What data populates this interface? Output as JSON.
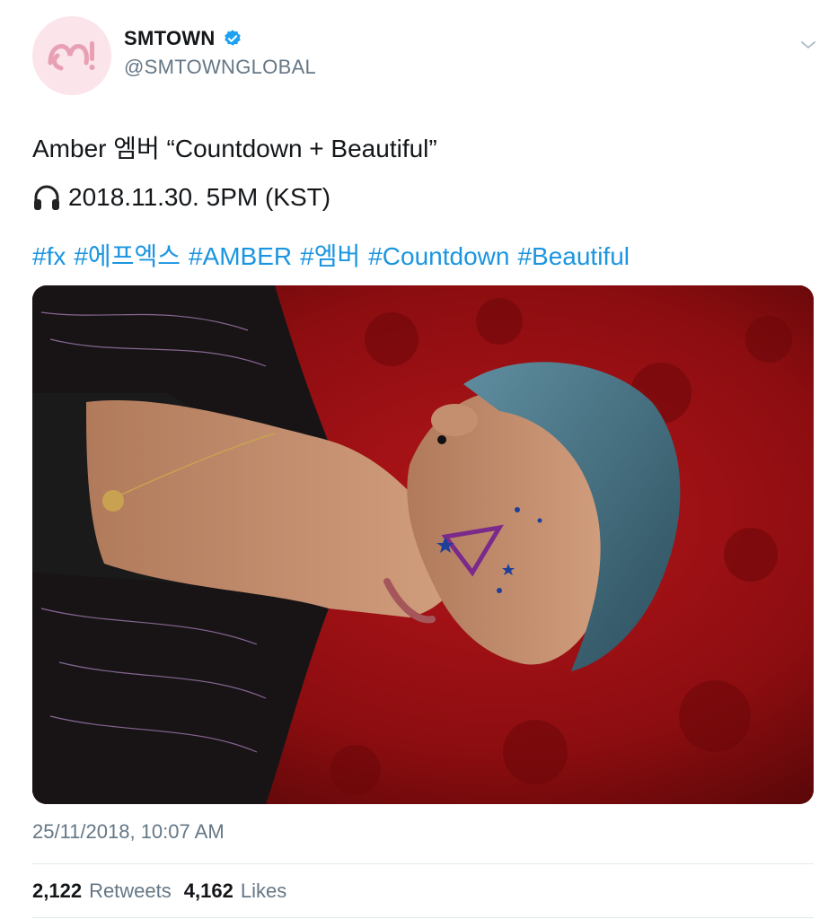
{
  "header": {
    "display_name": "SMTOWN",
    "handle": "@SMTOWNGLOBAL",
    "avatar_icon": "smtown-logo-icon",
    "verified_icon": "verified-badge-icon",
    "menu_icon": "chevron-down-icon"
  },
  "tweet": {
    "line1": "Amber 엠버 “Countdown + Beautiful”",
    "line2_icon": "headphones-icon",
    "line2_text": "2018.11.30. 5PM (KST)",
    "hashtags": [
      "#fx",
      "#에프엑스",
      "#AMBER",
      "#엠버",
      "#Countdown",
      "#Beautiful"
    ]
  },
  "media": {
    "image_alt": ""
  },
  "meta": {
    "timestamp": "25/11/2018, 10:07 AM"
  },
  "stats": {
    "retweets_count": "2,122",
    "retweets_label": "Retweets",
    "likes_count": "4,162",
    "likes_label": "Likes"
  },
  "colors": {
    "link": "#1b95e0",
    "verified": "#1da1f2",
    "secondary_text": "#657786",
    "avatar_bg": "#fbe4ea",
    "avatar_logo": "#e8a0b4"
  }
}
